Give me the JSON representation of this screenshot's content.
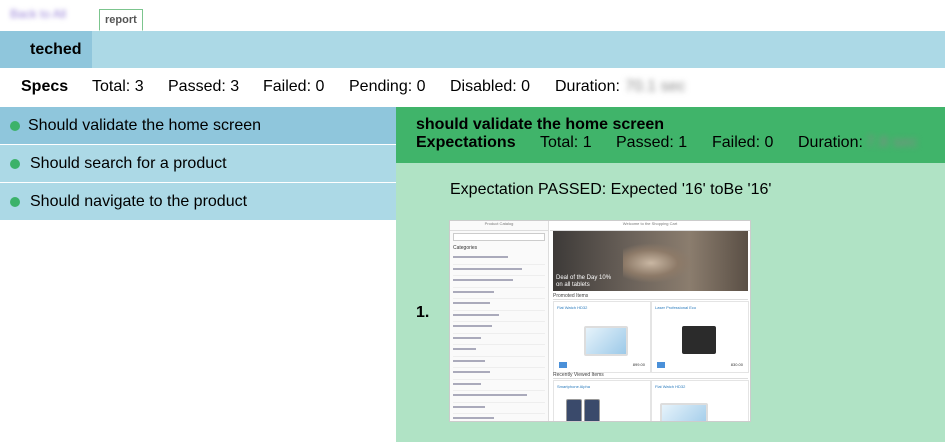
{
  "header": {
    "back_link": "Back to All",
    "tab_label": "report"
  },
  "suite": {
    "name": "teched"
  },
  "stats": {
    "specs_label": "Specs",
    "total": "Total: 3",
    "passed": "Passed: 3",
    "failed": "Failed: 0",
    "pending": "Pending: 0",
    "disabled": "Disabled: 0",
    "duration_label": "Duration:",
    "duration_value": "70.1 sec"
  },
  "specs": [
    {
      "label": "Should validate the home screen",
      "status": "passed"
    },
    {
      "label": "Should search for a product",
      "status": "passed"
    },
    {
      "label": "Should navigate to the product",
      "status": "passed"
    }
  ],
  "detail": {
    "title": "should validate the home screen",
    "expectations_label": "Expectations",
    "total": "Total: 1",
    "passed": "Passed: 1",
    "failed": "Failed: 0",
    "duration_label": "Duration:",
    "duration_value": "7.8 sec",
    "expectation_text": "Expectation PASSED: Expected '16' toBe '16'",
    "screenshot_index": "1."
  },
  "screenshot": {
    "side_title": "Product Catalog",
    "categories_label": "Categories",
    "main_title": "Welcome to the Shopping Cart",
    "banner_text": "Deal of the Day 10% on all tablets",
    "promoted_label": "Promoted Items",
    "recent_label": "Recently Viewed Items",
    "products": [
      {
        "name": "Flat Watch HD32",
        "price": "899.00"
      },
      {
        "name": "Laser Professional Eco",
        "price": "830.00"
      },
      {
        "name": "Smartphone Alpha",
        "price": ""
      },
      {
        "name": "Flat Watch HD32",
        "price": ""
      }
    ]
  },
  "colors": {
    "suite_bar": "#acd9e6",
    "suite_name_bg": "#8fc6dc",
    "passed_header": "#40b46a",
    "passed_body": "#b0e3c5",
    "status_dot": "#3cb26a"
  }
}
